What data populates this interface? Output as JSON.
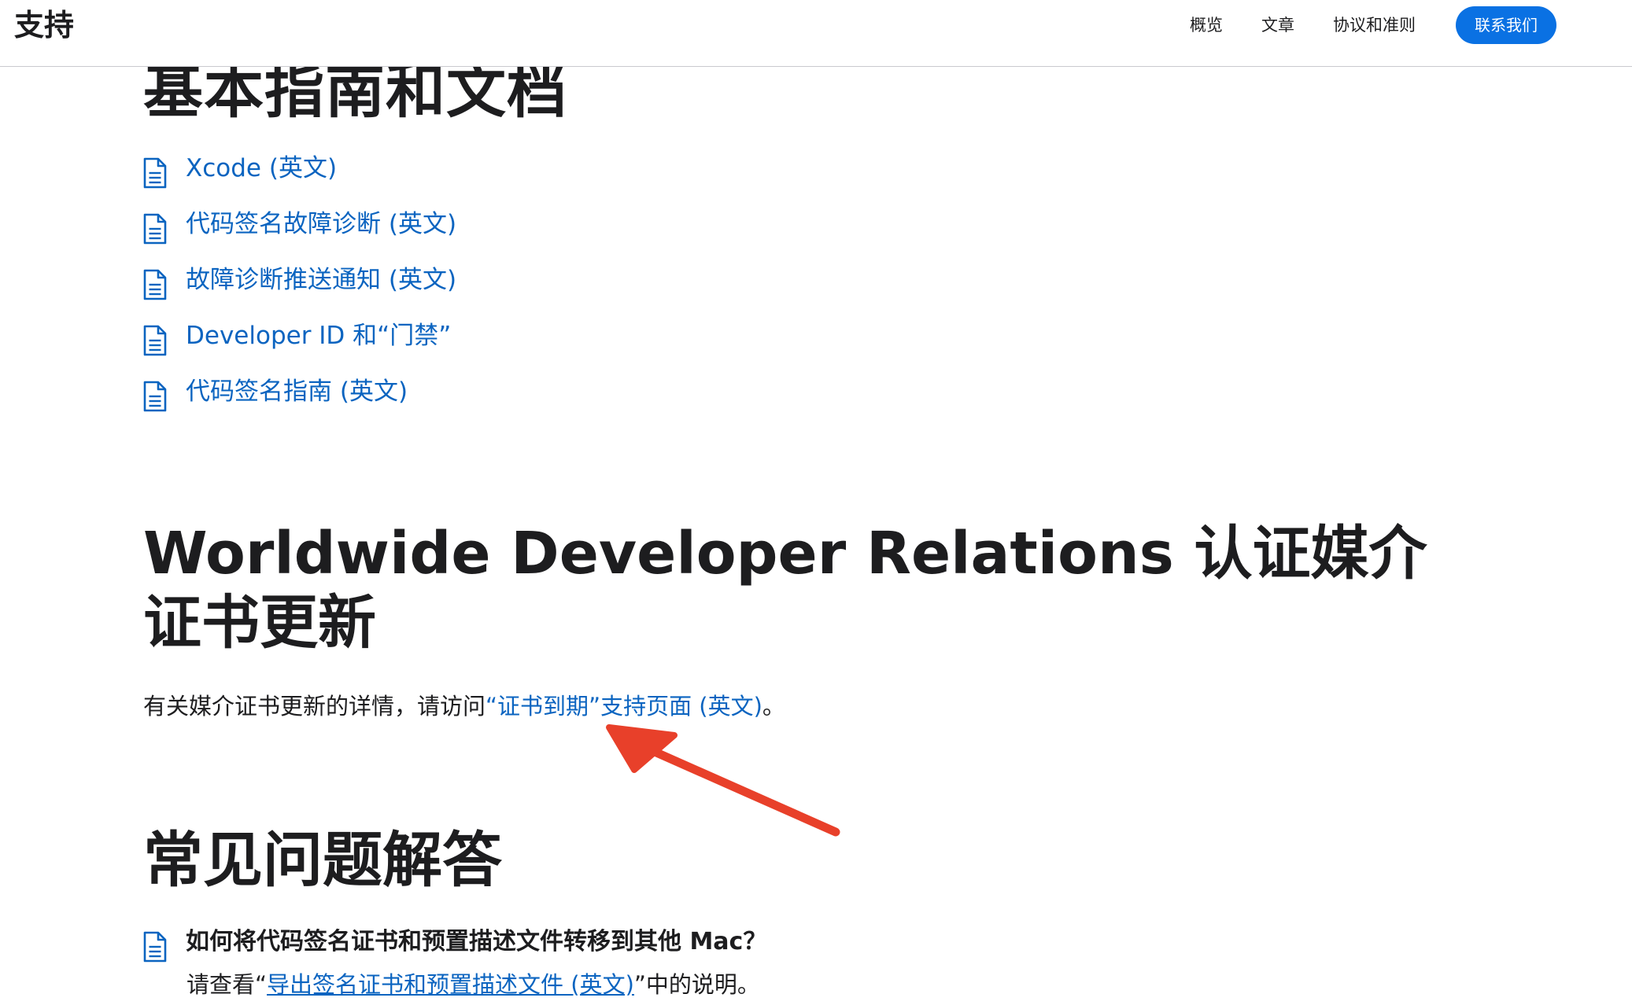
{
  "header": {
    "brand": "支持",
    "nav": {
      "overview": "概览",
      "articles": "文章",
      "agreements": "协议和准则"
    },
    "contact_button": "联系我们"
  },
  "docs_section": {
    "title": "基本指南和文档",
    "items": [
      {
        "label": "Xcode (英文)",
        "icon": "document-icon"
      },
      {
        "label": "代码签名故障诊断 (英文)",
        "icon": "document-icon"
      },
      {
        "label": "故障诊断推送通知 (英文)",
        "icon": "document-icon"
      },
      {
        "label": "Developer ID 和“门禁”",
        "icon": "document-icon"
      },
      {
        "label": "代码签名指南 (英文)",
        "icon": "document-icon"
      }
    ]
  },
  "wwdr_section": {
    "title": "Worldwide Developer Relations 认证媒介证书更新",
    "text_before": "有关媒介证书更新的详情，请访问",
    "link": "“证书到期”支持页面 (英文)",
    "text_after": "。"
  },
  "faq_section": {
    "title": "常见问题解答",
    "items": [
      {
        "question": "如何将代码签名证书和预置描述文件转移到其他 Mac？",
        "answer_before": "请查看“",
        "answer_link": "导出签名证书和预置描述文件 (英文)",
        "answer_after": "”中的说明。"
      }
    ]
  },
  "annotation": {
    "arrow_color": "#e8402a"
  },
  "colors": {
    "link": "#0b64c0",
    "button": "#0a71e3",
    "text": "#1d1d1f"
  }
}
